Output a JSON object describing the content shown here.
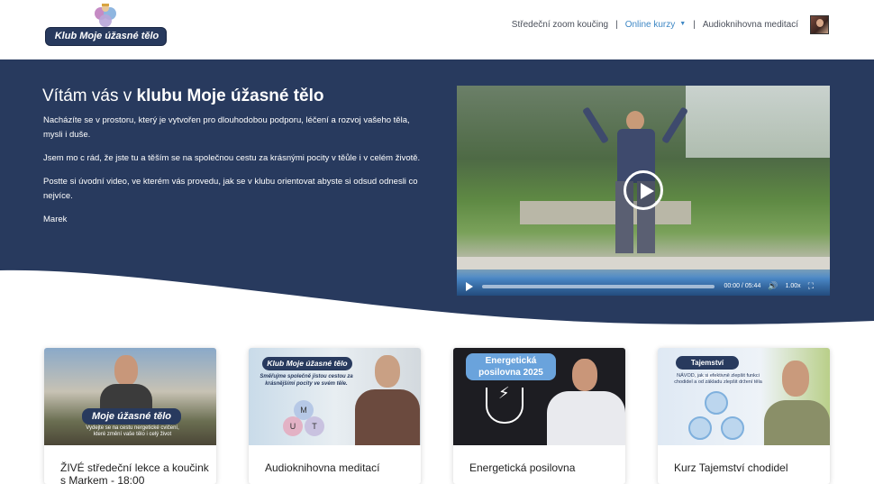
{
  "header": {
    "logo_text": "Klub Moje úžasné tělo",
    "nav": [
      {
        "label": "Středeční zoom koučing"
      },
      {
        "label": "Online kurzy"
      },
      {
        "label": "Audioknihovna meditací"
      }
    ],
    "separator": "|",
    "active_color": "#3f88c5"
  },
  "hero": {
    "title_prefix": "Vítám vás v ",
    "title_bold": "klubu Moje úžasné tělo",
    "paragraphs": [
      "Nacházíte se v prostoru, který je vytvořen pro dlouhodobou podporu, léčení a rozvoj vašeho těla, mysli i duše.",
      "Jsem mo c rád, že jste tu a těším se na společnou cestu za krásnými pocity v těůle i v celém životě.",
      "Postte si úvodní video, ve kterém vás provedu, jak se v klubu orientovat abyste si odsud odnesli co nejvíce.",
      "Marek"
    ],
    "background_color": "#283a5e"
  },
  "video": {
    "time": "00:00 / 05:44",
    "speed": "1.00x",
    "icons": [
      "play-icon",
      "volume-icon",
      "fullscreen-icon"
    ]
  },
  "cards": [
    {
      "title": "ŽIVÉ středeční lekce a koučink s Markem - 18:00",
      "badge": "Moje úžasné tělo",
      "sub_1": "Vydejte se na cestu nergetické cvičení,",
      "sub_2": "které změní vaše tělo i celý život"
    },
    {
      "title": "Audioknihovna meditací",
      "badge": "Klub Moje úžasné tělo",
      "sub": "Směřujme společně jistou cestou za krásnějšími pocity ve svém těle.",
      "circle_letters": [
        "M",
        "U",
        "T"
      ]
    },
    {
      "title": "Energetická posilovna",
      "badge_line_1": "Energetická",
      "badge_line_2": "posilovna 2025"
    },
    {
      "title": "Kurz Tajemství chodidel",
      "badge": "Tajemství chodidel",
      "sub_1": "NÁVOD, jak si efektivně zlepšit funkci",
      "sub_2": "chodidel a od základu zlepšit držení těla"
    }
  ]
}
